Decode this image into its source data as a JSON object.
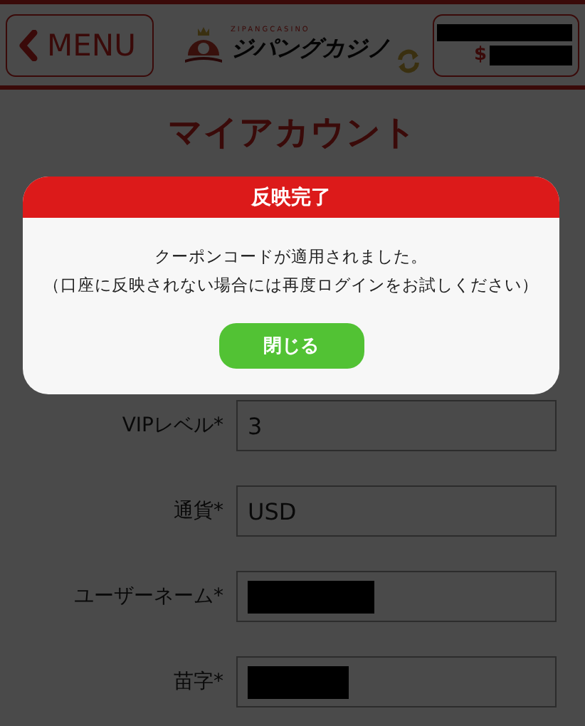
{
  "header": {
    "menu_button": {
      "label": "MENU"
    },
    "logo": {
      "tagline": "ZIPANGCASINO",
      "name": "ジパングカジノ"
    },
    "balance": {
      "currency": "$"
    }
  },
  "page_title": "マイアカウント",
  "form": [
    {
      "label": "VIPレベル*",
      "value": "3",
      "redacted": false
    },
    {
      "label": "通貨*",
      "value": "USD",
      "redacted": false
    },
    {
      "label": "ユーザーネーム*",
      "redacted": true
    },
    {
      "label": "苗字*",
      "redacted": true
    }
  ],
  "dialog": {
    "title": "反映完了",
    "message": "クーポンコードが適用されました。",
    "note": "（口座に反映されない場合には再度ログインをお試しください）",
    "button": "閉じる"
  }
}
